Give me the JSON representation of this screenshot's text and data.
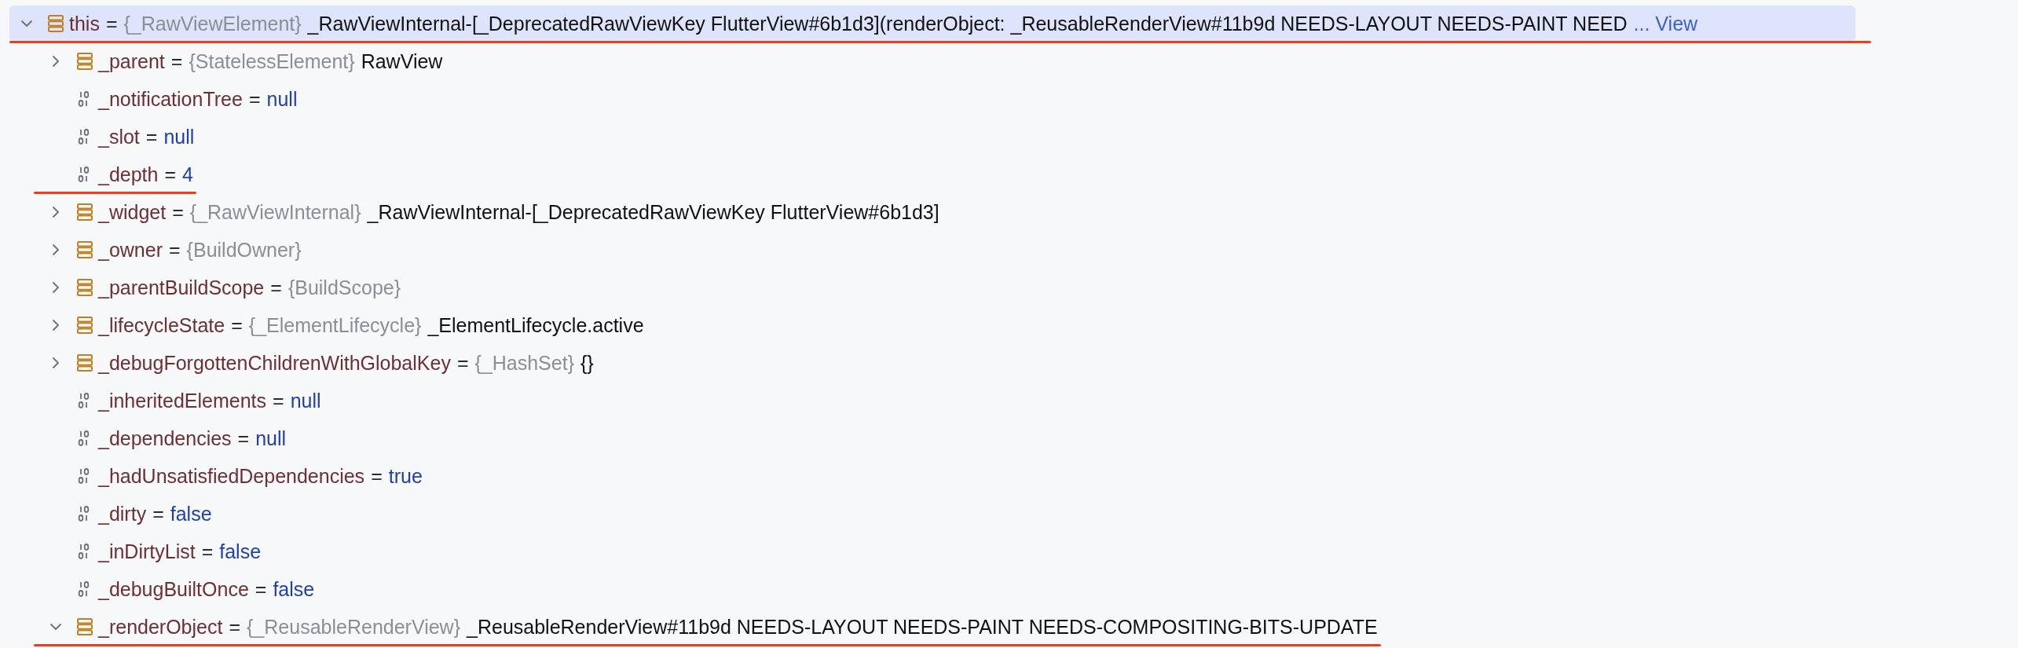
{
  "tree": {
    "name": "this",
    "eq": "=",
    "type": "{_RawViewElement}",
    "value": "_RawViewInternal-[_DeprecatedRawViewKey FlutterView#6b1d3](renderObject: _ReusableRenderView#11b9d NEEDS-LAYOUT NEEDS-PAINT NEED",
    "more_link": "... View",
    "kind": "object",
    "expanded": true,
    "selected": true,
    "underlined": true,
    "children": [
      {
        "name": "_parent",
        "eq": "=",
        "type": "{StatelessElement}",
        "value": "RawView",
        "kind": "object",
        "expanded": false,
        "selected": false,
        "underlined": false
      },
      {
        "name": "_notificationTree",
        "eq": "=",
        "value": "null",
        "kind": "primitive",
        "selected": false,
        "underlined": false
      },
      {
        "name": "_slot",
        "eq": "=",
        "value": "null",
        "kind": "primitive",
        "selected": false,
        "underlined": false
      },
      {
        "name": "_depth",
        "eq": "=",
        "value": "4",
        "kind": "primitive",
        "selected": false,
        "underlined": true
      },
      {
        "name": "_widget",
        "eq": "=",
        "type": "{_RawViewInternal}",
        "value": "_RawViewInternal-[_DeprecatedRawViewKey FlutterView#6b1d3]",
        "kind": "object",
        "expanded": false,
        "selected": false,
        "underlined": false
      },
      {
        "name": "_owner",
        "eq": "=",
        "type": "{BuildOwner}",
        "kind": "object",
        "expanded": false,
        "selected": false,
        "underlined": false
      },
      {
        "name": "_parentBuildScope",
        "eq": "=",
        "type": "{BuildScope}",
        "kind": "object",
        "expanded": false,
        "selected": false,
        "underlined": false
      },
      {
        "name": "_lifecycleState",
        "eq": "=",
        "type": "{_ElementLifecycle}",
        "value": "_ElementLifecycle.active",
        "kind": "object",
        "expanded": false,
        "selected": false,
        "underlined": false
      },
      {
        "name": "_debugForgottenChildrenWithGlobalKey",
        "eq": "=",
        "type": "{_HashSet}",
        "value": "{}",
        "kind": "object",
        "expanded": false,
        "selected": false,
        "underlined": false
      },
      {
        "name": "_inheritedElements",
        "eq": "=",
        "value": "null",
        "kind": "primitive",
        "selected": false,
        "underlined": false
      },
      {
        "name": "_dependencies",
        "eq": "=",
        "value": "null",
        "kind": "primitive",
        "selected": false,
        "underlined": false
      },
      {
        "name": "_hadUnsatisfiedDependencies",
        "eq": "=",
        "value": "true",
        "kind": "primitive",
        "selected": false,
        "underlined": false
      },
      {
        "name": "_dirty",
        "eq": "=",
        "value": "false",
        "kind": "primitive",
        "selected": false,
        "underlined": false
      },
      {
        "name": "_inDirtyList",
        "eq": "=",
        "value": "false",
        "kind": "primitive",
        "selected": false,
        "underlined": false
      },
      {
        "name": "_debugBuiltOnce",
        "eq": "=",
        "value": "false",
        "kind": "primitive",
        "selected": false,
        "underlined": false
      },
      {
        "name": "_renderObject",
        "eq": "=",
        "type": "{_ReusableRenderView}",
        "value": "_ReusableRenderView#11b9d NEEDS-LAYOUT NEEDS-PAINT NEEDS-COMPOSITING-BITS-UPDATE",
        "kind": "object",
        "expanded": true,
        "selected": false,
        "underlined": true
      }
    ]
  }
}
